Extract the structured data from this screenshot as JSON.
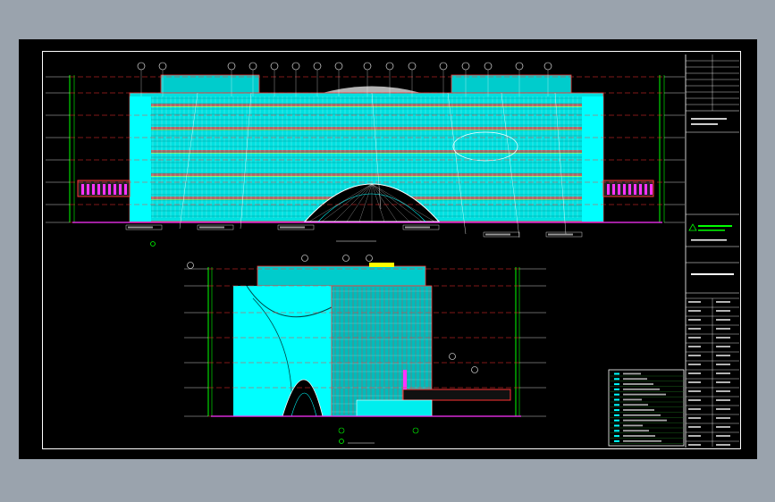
{
  "colors": {
    "background": "#9aa3ad",
    "viewport": "#000000",
    "cyan": "#00ffff",
    "red": "#ff3333",
    "green": "#00ff00",
    "yellow": "#ffff00",
    "magenta": "#ff33ff",
    "white": "#ffffff"
  },
  "drawing": {
    "front_elevation_caption": "",
    "side_elevation_caption": ""
  },
  "title_block": {
    "rows": 8
  },
  "legend": {
    "rows": 14
  }
}
